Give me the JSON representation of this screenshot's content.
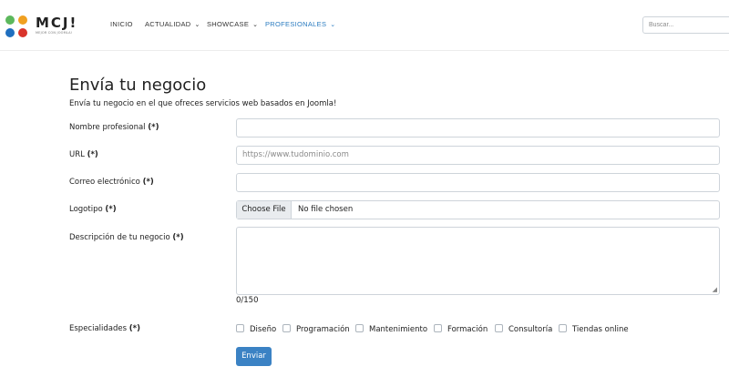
{
  "header": {
    "logo_text": "MCJ!",
    "logo_tagline": "MEJOR CON JOOMLA!",
    "nav": [
      {
        "label": "INICIO",
        "has_dropdown": false,
        "active": false
      },
      {
        "label": "ACTUALIDAD",
        "has_dropdown": true,
        "active": false
      },
      {
        "label": "SHOWCASE",
        "has_dropdown": true,
        "active": false
      },
      {
        "label": "PROFESIONALES",
        "has_dropdown": true,
        "active": true
      }
    ],
    "chevron": "⌄",
    "search_placeholder": "Buscar..."
  },
  "page": {
    "title": "Envía tu negocio",
    "intro": "Envía tu negocio en el que ofreces servicios web basados en Joomla!"
  },
  "form": {
    "required_mark": "(*)",
    "nombre": {
      "label": "Nombre profesional",
      "value": ""
    },
    "url": {
      "label": "URL",
      "placeholder": "https://www.tudominio.com"
    },
    "correo": {
      "label": "Correo electrónico",
      "value": ""
    },
    "logotipo": {
      "label": "Logotipo",
      "button": "Choose File",
      "status": "No file chosen"
    },
    "descripcion": {
      "label": "Descripción de tu negocio",
      "value": "",
      "counter": "0/150"
    },
    "especialidades": {
      "label": "Especialidades",
      "options": [
        "Diseño",
        "Programación",
        "Mantenimiento",
        "Formación",
        "Consultoría",
        "Tiendas online"
      ]
    },
    "submit_label": "Enviar"
  },
  "colors": {
    "accent": "#2a7bc0",
    "button": "#3b82c4"
  }
}
